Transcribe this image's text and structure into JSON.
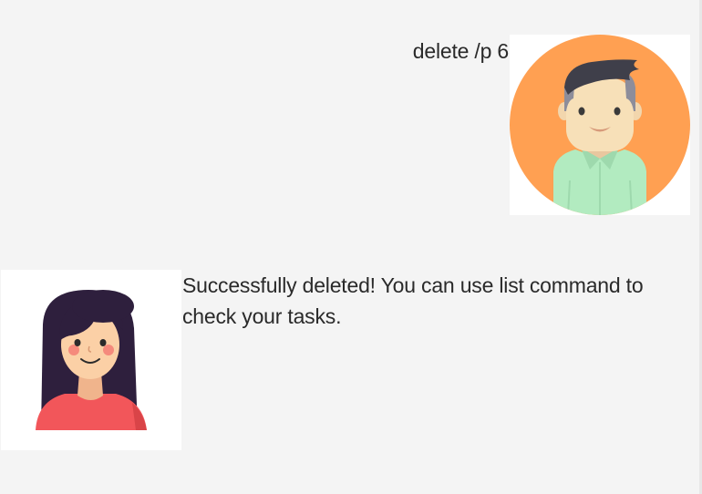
{
  "dialogs": [
    {
      "sender": "user",
      "text": "delete /p 6",
      "avatar_icon": "man-avatar-icon"
    },
    {
      "sender": "bot",
      "text": "Successfully deleted! You can use list command to check your tasks.",
      "avatar_icon": "woman-avatar-icon"
    }
  ],
  "colors": {
    "background": "#f4f4f4",
    "user_avatar_circle": "#ffa052",
    "user_shirt": "#b2ebc0",
    "bot_shirt": "#f2565a",
    "bot_hair": "#2e1f3d",
    "text": "#2a2a2a"
  }
}
